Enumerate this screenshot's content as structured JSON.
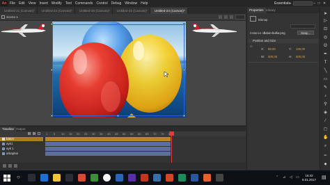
{
  "app": {
    "logo": "An",
    "menu": [
      "File",
      "Edit",
      "View",
      "Insert",
      "Modify",
      "Text",
      "Commands",
      "Control",
      "Debug",
      "Window",
      "Help"
    ],
    "workspace": "Essentials",
    "window_controls": [
      "–",
      "□",
      "✕"
    ]
  },
  "document_tabs": [
    {
      "label": "Untitled-21 (Canvas)*",
      "active": false
    },
    {
      "label": "Untitled-22 (Canvas)*",
      "active": false
    },
    {
      "label": "Untitled-25 (Canvas)*",
      "active": false
    },
    {
      "label": "Untitled-23 (Canvas)*",
      "active": false
    },
    {
      "label": "Untitled-24 (Canvas)*",
      "active": true
    }
  ],
  "scene": {
    "label": "Scene 1"
  },
  "stage": {
    "watermark_left": "TURKISH AIRLINES",
    "watermark_right": "TURKISH AIRLINES"
  },
  "timeline": {
    "tabs": [
      "Timeline",
      "Output"
    ],
    "ruler": [
      "1",
      "5",
      "10",
      "15",
      "20",
      "25",
      "30",
      "35",
      "40",
      "45",
      "50",
      "55",
      "60",
      "65",
      "70",
      "75",
      "80"
    ],
    "layers": [
      {
        "name": "balon",
        "selected": true
      },
      {
        "name": "ayk1",
        "selected": false
      },
      {
        "name": "ayk 1",
        "selected": false
      },
      {
        "name": "arkaplan",
        "selected": false
      }
    ]
  },
  "properties": {
    "tabs": [
      "Properties",
      "Library"
    ],
    "type": "Bitmap",
    "instance_label": "Instance of:",
    "instance_value": "balon-bullur.png",
    "swap_button": "Swap...",
    "section_position": "Position and Size",
    "x_label": "X:",
    "x_value": "88,00",
    "y_label": "Y:",
    "y_value": "126,00",
    "w_label": "W:",
    "w_value": "500,00",
    "h_label": "H:",
    "h_value": "500,00"
  },
  "taskbar": {
    "time": "16:42",
    "date": "8.01.2017"
  },
  "colors": {
    "accent_layer": "#a97f1d",
    "playhead": "#e23b3b",
    "property_value": "#e6a23c"
  }
}
